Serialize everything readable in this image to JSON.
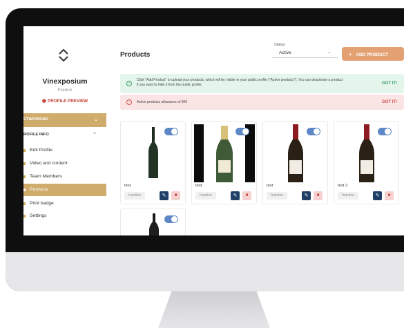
{
  "sidebar": {
    "brand_name": "Vinexposium",
    "country": "France",
    "profile_preview": "PROFILE PREVIEW",
    "networking": "ETWORKING",
    "profile_info": "ROFILE INFO",
    "items": [
      {
        "label": "Edit Profile"
      },
      {
        "label": "Video and content"
      },
      {
        "label": "Team Members"
      },
      {
        "label": "Products",
        "active": true
      },
      {
        "label": "Print badge"
      },
      {
        "label": "Settings"
      }
    ]
  },
  "header": {
    "title": "Products",
    "status_label": "Status",
    "status_value": "Active",
    "add_button": "ADD PRODUCT"
  },
  "alerts": {
    "info_text": "Click \"Add Product\" to upload your products, which will be visible in your public profile (\"Active products\"). You can deactivate a product if you want to hide it from the public profile.",
    "info_action": "GOT IT!",
    "warn_text": "Active products allowance of 300",
    "warn_action": "GOT IT!"
  },
  "products": [
    {
      "name": "test",
      "status": "Inactive",
      "image": "dark-green-bottle"
    },
    {
      "name": "test",
      "status": "Inactive",
      "image": "champagne-bottle"
    },
    {
      "name": "test",
      "status": "Inactive",
      "image": "red-burgundy-bottle"
    },
    {
      "name": "test 2",
      "status": "Inactive",
      "image": "red-burgundy-bottle"
    },
    {
      "name": "",
      "status": "",
      "image": "dark-bottle"
    }
  ],
  "colors": {
    "accent_gold": "#cfac6c",
    "add_button": "#e3a072",
    "toggle_blue": "#5d87c6",
    "edit_navy": "#1f3f66",
    "info_bg": "#e4f5ec",
    "warn_bg": "#fbe4e4"
  }
}
